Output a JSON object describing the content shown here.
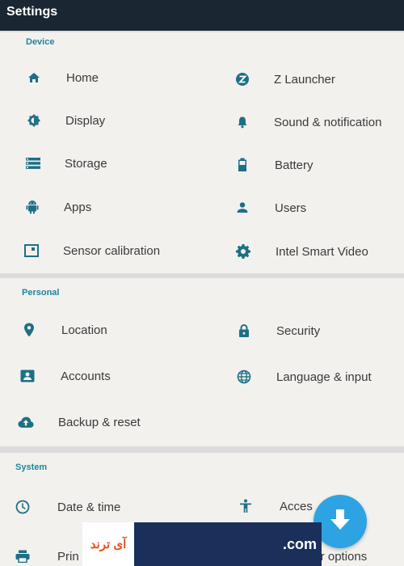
{
  "header": {
    "title": "Settings"
  },
  "colors": {
    "accent": "#20859b",
    "icon": "#1e6f86",
    "titlebar": "#1b2633",
    "fab": "#2ea3e3"
  },
  "sections": {
    "device": {
      "label": "Device",
      "items": [
        {
          "label": "Home",
          "icon": "home-icon"
        },
        {
          "label": "Z Launcher",
          "icon": "z-launcher-icon"
        },
        {
          "label": "Display",
          "icon": "brightness-icon"
        },
        {
          "label": "Sound & notification",
          "icon": "bell-icon"
        },
        {
          "label": "Storage",
          "icon": "storage-icon"
        },
        {
          "label": "Battery",
          "icon": "battery-icon"
        },
        {
          "label": "Apps",
          "icon": "android-icon"
        },
        {
          "label": "Users",
          "icon": "person-icon"
        },
        {
          "label": "Sensor calibration",
          "icon": "sensor-icon"
        },
        {
          "label": "Intel Smart Video",
          "icon": "gear-icon"
        }
      ]
    },
    "personal": {
      "label": "Personal",
      "items": [
        {
          "label": "Location",
          "icon": "location-pin-icon"
        },
        {
          "label": "Security",
          "icon": "lock-icon"
        },
        {
          "label": "Accounts",
          "icon": "account-icon"
        },
        {
          "label": "Language & input",
          "icon": "globe-icon"
        },
        {
          "label": "Backup & reset",
          "icon": "cloud-upload-icon"
        }
      ]
    },
    "system": {
      "label": "System",
      "items": [
        {
          "label": "Date & time",
          "icon": "clock-icon"
        },
        {
          "label": "Acces",
          "icon": "accessibility-icon"
        },
        {
          "label": "Prin",
          "icon": "print-icon"
        },
        {
          "label": "per options",
          "icon": "developer-options-icon"
        }
      ]
    }
  },
  "watermark": {
    "text_left": "آی ترند",
    "text_right": ".com"
  }
}
